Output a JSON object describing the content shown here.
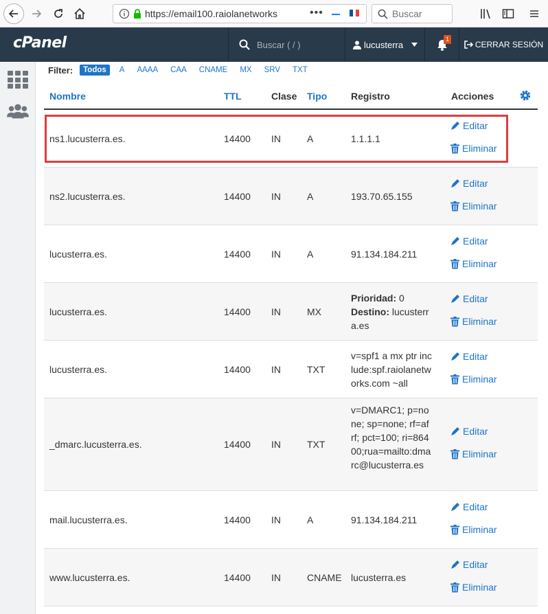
{
  "browser": {
    "url": "https://email100.raiolanetworks",
    "url_more": "•••",
    "search_placeholder": "Buscar"
  },
  "header": {
    "logo": "cPanel",
    "search_placeholder": "Buscar ( / )",
    "username": "lucusterra",
    "notifications_count": "1",
    "logout_label": "CERRAR SESIÓN"
  },
  "filter": {
    "label": "Filter:",
    "items": [
      "Todos",
      "A",
      "AAAA",
      "CAA",
      "CNAME",
      "MX",
      "SRV",
      "TXT"
    ],
    "active": "Todos"
  },
  "table": {
    "headers": {
      "name": "Nombre",
      "ttl": "TTL",
      "class": "Clase",
      "type": "Tipo",
      "record": "Registro",
      "actions": "Acciones"
    },
    "edit_label": "Editar",
    "delete_label": "Eliminar",
    "rows": [
      {
        "name": "ns1.lucusterra.es.",
        "ttl": "14400",
        "class": "IN",
        "type": "A",
        "record": "1.1.1.1"
      },
      {
        "name": "ns2.lucusterra.es.",
        "ttl": "14400",
        "class": "IN",
        "type": "A",
        "record": "193.70.65.155"
      },
      {
        "name": "lucusterra.es.",
        "ttl": "14400",
        "class": "IN",
        "type": "A",
        "record": "91.134.184.211"
      },
      {
        "name": "lucusterra.es.",
        "ttl": "14400",
        "class": "IN",
        "type": "MX",
        "record": "",
        "priority_label": "Prioridad:",
        "priority": "0",
        "dest_label": "Destino:",
        "dest": "lucusterra.es"
      },
      {
        "name": "lucusterra.es.",
        "ttl": "14400",
        "class": "IN",
        "type": "TXT",
        "record": "v=spf1 a mx ptr include:spf.raiolanetworks.com ~all"
      },
      {
        "name": "_dmarc.lucusterra.es.",
        "ttl": "14400",
        "class": "IN",
        "type": "TXT",
        "record": "v=DMARC1; p=none; sp=none; rf=afrf; pct=100; ri=86400;rua=mailto:dmarc@lucusterra.es"
      },
      {
        "name": "mail.lucusterra.es.",
        "ttl": "14400",
        "class": "IN",
        "type": "A",
        "record": "91.134.184.211"
      },
      {
        "name": "www.lucusterra.es.",
        "ttl": "14400",
        "class": "IN",
        "type": "CNAME",
        "record": "lucusterra.es"
      }
    ]
  },
  "colors": {
    "link": "#1e74c9",
    "header_bg": "#293a4a",
    "highlight": "#e03c3c"
  }
}
